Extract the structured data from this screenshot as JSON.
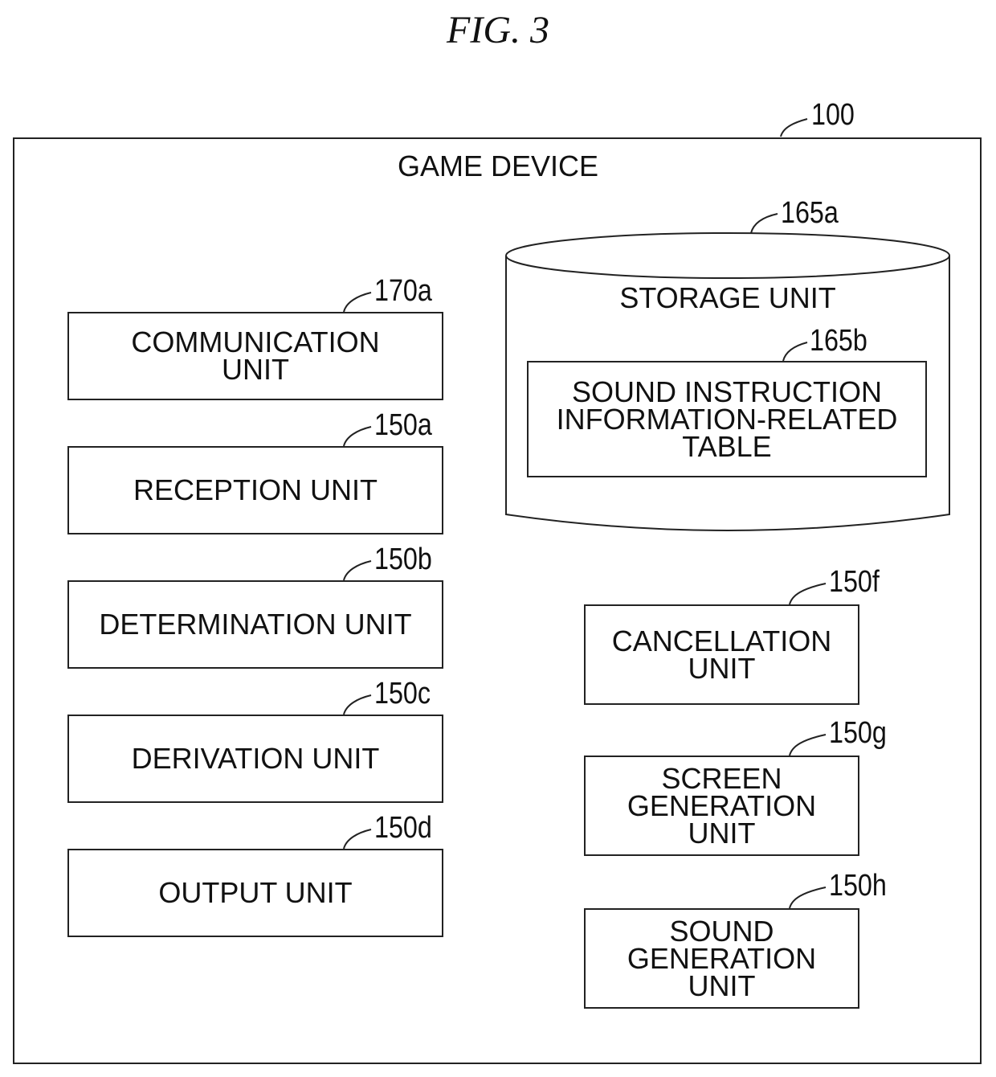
{
  "figure": {
    "title": "FIG. 3"
  },
  "device": {
    "ref": "100",
    "title": "GAME DEVICE"
  },
  "storage": {
    "ref": "165a",
    "label": "STORAGE UNIT",
    "table": {
      "ref": "165b",
      "label": "SOUND INSTRUCTION\nINFORMATION-RELATED\nTABLE"
    }
  },
  "left_units": [
    {
      "ref": "170a",
      "label": "COMMUNICATION\nUNIT"
    },
    {
      "ref": "150a",
      "label": "RECEPTION UNIT"
    },
    {
      "ref": "150b",
      "label": "DETERMINATION UNIT"
    },
    {
      "ref": "150c",
      "label": "DERIVATION UNIT"
    },
    {
      "ref": "150d",
      "label": "OUTPUT UNIT"
    }
  ],
  "right_units": [
    {
      "ref": "150f",
      "label": "CANCELLATION\nUNIT"
    },
    {
      "ref": "150g",
      "label": "SCREEN\nGENERATION\nUNIT"
    },
    {
      "ref": "150h",
      "label": "SOUND\nGENERATION\nUNIT"
    }
  ]
}
